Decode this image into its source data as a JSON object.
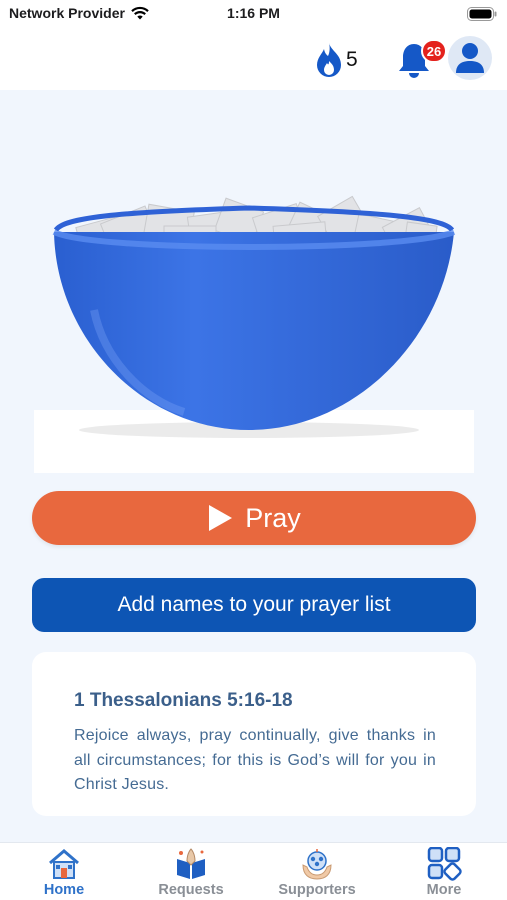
{
  "status_bar": {
    "carrier": "Network Provider",
    "time": "1:16 PM"
  },
  "header": {
    "streak_count": "5",
    "notification_count": "26",
    "icons": [
      "flame-icon",
      "bell-icon",
      "user-avatar-icon"
    ]
  },
  "main": {
    "pray_button_label": "Pray",
    "add_names_button_label": "Add names to your prayer list",
    "verse": {
      "reference": "1 Thessalonians 5:16-18",
      "text": "Rejoice always, pray continually, give thanks in all circumstances; for this is God’s will for you in Christ Jesus."
    }
  },
  "tabs": [
    {
      "label": "Home",
      "icon": "home-icon",
      "active": true
    },
    {
      "label": "Requests",
      "icon": "praying-book-icon",
      "active": false
    },
    {
      "label": "Supporters",
      "icon": "supporters-hands-icon",
      "active": false
    },
    {
      "label": "More",
      "icon": "grid-more-icon",
      "active": false
    }
  ],
  "colors": {
    "accent_orange": "#e8683e",
    "primary_blue": "#0d55b4",
    "active_tab": "#2f72c9",
    "inactive_tab": "#8a8f96",
    "background": "#f1f6fd"
  }
}
